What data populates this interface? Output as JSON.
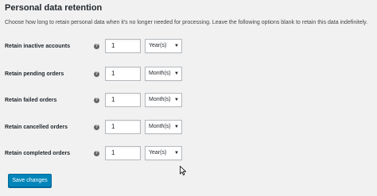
{
  "section": {
    "title": "Personal data retention",
    "description": "Choose how long to retain personal data when it's no longer needed for processing. Leave the following options blank to retain this data indefinitely."
  },
  "rows": [
    {
      "label": "Retain inactive accounts",
      "value": "1",
      "unit": "Year(s)",
      "help_icon": "help-icon"
    },
    {
      "label": "Retain pending orders",
      "value": "1",
      "unit": "Month(s)",
      "help_icon": "help-icon"
    },
    {
      "label": "Retain failed orders",
      "value": "1",
      "unit": "Month(s)",
      "help_icon": "help-icon"
    },
    {
      "label": "Retain cancelled orders",
      "value": "1",
      "unit": "Month(s)",
      "help_icon": "help-icon"
    },
    {
      "label": "Retain completed orders",
      "value": "1",
      "unit": "Year(s)",
      "help_icon": "help-icon"
    }
  ],
  "footer": {
    "save_label": "Save changes"
  },
  "colors": {
    "primary_button": "#0085ba",
    "background": "#f1f1f1"
  }
}
